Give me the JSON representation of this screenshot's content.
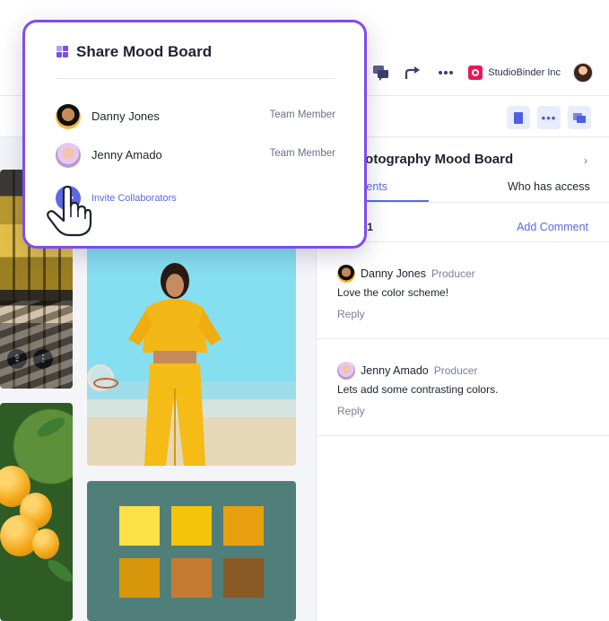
{
  "topbar": {
    "company_name": "StudioBinder Inc",
    "icons": [
      "chat-bubbles-icon",
      "share-arrow-icon",
      "more-dots-icon"
    ]
  },
  "subbar": {
    "icons": [
      "notebook-icon",
      "more-dots-icon",
      "comments-icon"
    ]
  },
  "panel": {
    "title": "Photography Mood Board",
    "tab_active": "Comments",
    "tab_access": "Who has access",
    "version_label": "V.1",
    "add_comment": "Add Comment",
    "comments": [
      {
        "name": "Danny Jones",
        "role": "Producer",
        "text": "Love the color scheme!",
        "reply": "Reply"
      },
      {
        "name": "Jenny Amado",
        "role": "Producer",
        "text": "Lets add some contrasting colors.",
        "reply": "Reply"
      }
    ]
  },
  "canvas": {
    "palette_colors": [
      "#fde046",
      "#f3c40a",
      "#e8a00f",
      "#d8960c",
      "#c47a31",
      "#8a5a26"
    ]
  },
  "modal": {
    "title": "Share Mood Board",
    "members": [
      {
        "name": "Danny Jones",
        "role": "Team Member"
      },
      {
        "name": "Jenny Amado",
        "role": "Team Member"
      }
    ],
    "invite_label": "Invite Collaborators",
    "accent": "#7e4cf0",
    "link_color": "#5b6ae3"
  }
}
